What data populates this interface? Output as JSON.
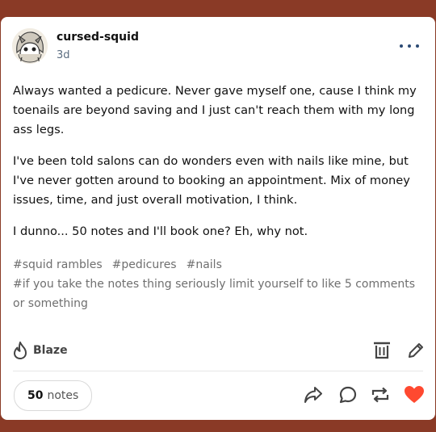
{
  "post": {
    "username": "cursed-squid",
    "timestamp": "3d",
    "paragraphs": [
      "Always wanted a pedicure. Never gave myself one, cause I think my toenails are beyond saving and I just can't reach them with my long ass legs.",
      "I've been told salons can do wonders even with nails like mine, but I've never gotten around to booking an appointment. Mix of money issues, time, and just overall motivation, I think.",
      "I dunno... 50 notes and I'll book one? Eh, why not."
    ],
    "tags": [
      "#squid rambles",
      "#pedicures",
      "#nails",
      "#if you take the notes thing seriously limit yourself to like 5 comments or something"
    ]
  },
  "actions": {
    "blaze_label": "Blaze",
    "notes_count": "50",
    "notes_label": "notes"
  },
  "icons": {
    "more": "more-dots-icon",
    "blaze": "flame-icon",
    "delete": "trash-icon",
    "edit": "pencil-icon",
    "share": "share-arrow-icon",
    "reply": "speech-bubble-icon",
    "reblog": "reblog-icon",
    "like": "heart-icon"
  },
  "colors": {
    "background": "#8a3a26",
    "card": "#ffffff",
    "accent_blue": "#2b4a74",
    "like_red": "#ff4930"
  }
}
